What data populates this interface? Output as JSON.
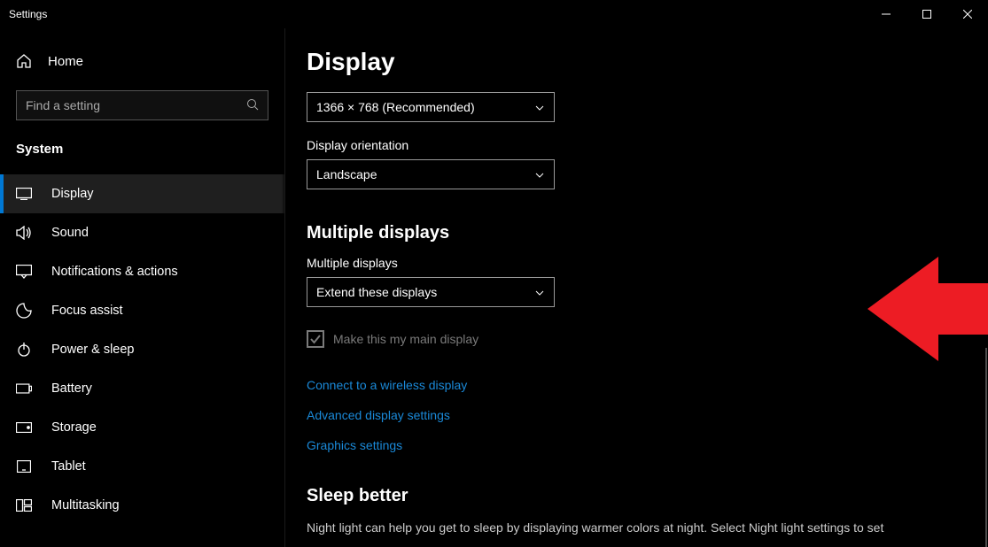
{
  "window": {
    "title": "Settings"
  },
  "sidebar": {
    "home_label": "Home",
    "search_placeholder": "Find a setting",
    "section_label": "System",
    "items": [
      {
        "label": "Display"
      },
      {
        "label": "Sound"
      },
      {
        "label": "Notifications & actions"
      },
      {
        "label": "Focus assist"
      },
      {
        "label": "Power & sleep"
      },
      {
        "label": "Battery"
      },
      {
        "label": "Storage"
      },
      {
        "label": "Tablet"
      },
      {
        "label": "Multitasking"
      }
    ]
  },
  "main": {
    "page_title": "Display",
    "resolution_value": "1366 × 768 (Recommended)",
    "orientation_label": "Display orientation",
    "orientation_value": "Landscape",
    "multi_heading": "Multiple displays",
    "multi_label": "Multiple displays",
    "multi_value": "Extend these displays",
    "main_display_checkbox": "Make this my main display",
    "links": {
      "wireless": "Connect to a wireless display",
      "advanced": "Advanced display settings",
      "graphics": "Graphics settings"
    },
    "sleep_heading": "Sleep better",
    "sleep_body": "Night light can help you get to sleep by displaying warmer colors at night. Select Night light settings to set"
  }
}
